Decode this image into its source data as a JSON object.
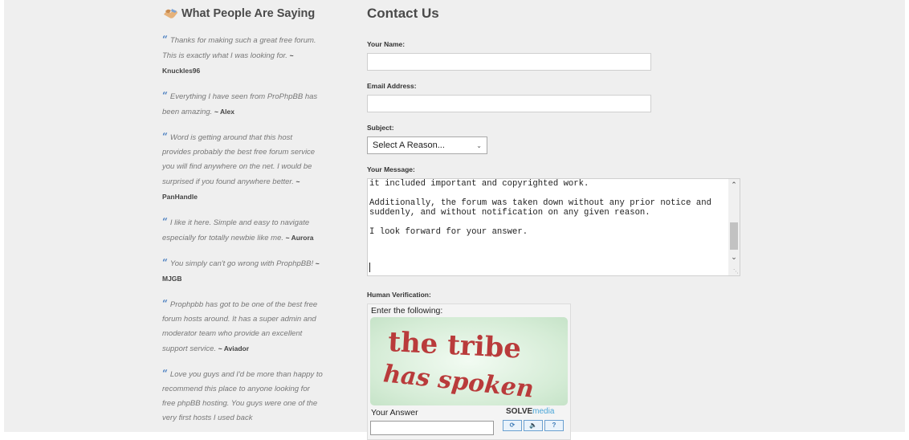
{
  "sidebar": {
    "title": "What People Are Saying",
    "testimonials": [
      {
        "text": "Thanks for making such a great free forum. This is exactly what I was looking for.",
        "author": "~ Knuckles96"
      },
      {
        "text": "Everything I have seen from ProPhpBB has been amazing.",
        "author": "~ Alex"
      },
      {
        "text": "Word is getting around that this host provides probably the best free forum service you will find anywhere on the net. I would be surprised if you found anywhere better.",
        "author": "~ PanHandle"
      },
      {
        "text": "I like it here. Simple and easy to navigate especially for totally newbie like me.",
        "author": "~ Aurora"
      },
      {
        "text": "You simply can't go wrong with ProphpBB!",
        "author": "~ MJGB"
      },
      {
        "text": "Prophpbb has got to be one of the best free forum hosts around. It has a super admin and moderator team who provide an excellent support service.",
        "author": "~ Aviador"
      },
      {
        "text": "Love you guys and I'd be more than happy to recommend this place to anyone looking for free phpBB hosting. You guys were one of the very first hosts I used back",
        "author": ""
      }
    ]
  },
  "form": {
    "title": "Contact Us",
    "name_label": "Your Name:",
    "name_value": "",
    "email_label": "Email Address:",
    "email_value": "",
    "subject_label": "Subject:",
    "subject_selected": "Select A Reason...",
    "message_label": "Your Message:",
    "message_value": "opportunity to get into the forum to download such posted data, as\nit included important and copyrighted work.\n\nAdditionally, the forum was taken down without any prior notice and\nsuddenly, and without notification on any given reason.\n\nI look forward for your answer.",
    "verification_label": "Human Verification:"
  },
  "captcha": {
    "prompt": "Enter the following:",
    "line1": "the tribe",
    "line2": "has spoken",
    "answer_label": "Your Answer",
    "brand_a": "SOLVE",
    "brand_b": "media",
    "buttons": [
      "⟳",
      "🔈",
      "?"
    ]
  },
  "colors": {
    "accent": "#4a7fc0",
    "captcha_text": "#b93b3b"
  }
}
